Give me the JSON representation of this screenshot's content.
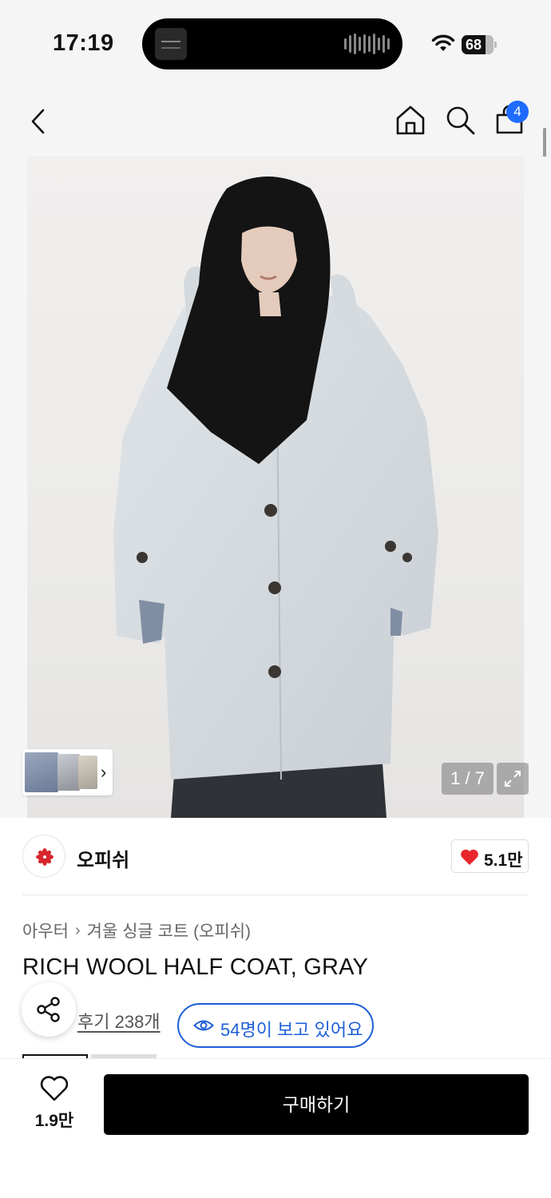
{
  "status_bar": {
    "time": "17:19",
    "battery": "68"
  },
  "nav": {
    "back_icon": "chevron-left-icon",
    "home_icon": "home-icon",
    "search_icon": "search-icon",
    "cart_icon": "shopping-bag-icon",
    "cart_badge": "4"
  },
  "gallery": {
    "counter": "1 / 7",
    "current_index": 1,
    "total": 7,
    "expand_icon": "expand-icon"
  },
  "brand": {
    "name": "오피쉬",
    "likes": "5.1만"
  },
  "product": {
    "breadcrumb": [
      "아우터",
      "겨울 싱글 코트 (오피쉬)"
    ],
    "title": "RICH WOOL HALF COAT, GRAY",
    "reviews": "후기 238개",
    "viewing": "54명이 보고 있어요"
  },
  "bottom_bar": {
    "wish_count": "1.9만",
    "buy_label": "구매하기"
  },
  "colors": {
    "accent_blue": "#1e5ed8",
    "badge_blue": "#1e6bff",
    "heart_red": "#e8262b",
    "buy_button": "#000000"
  }
}
